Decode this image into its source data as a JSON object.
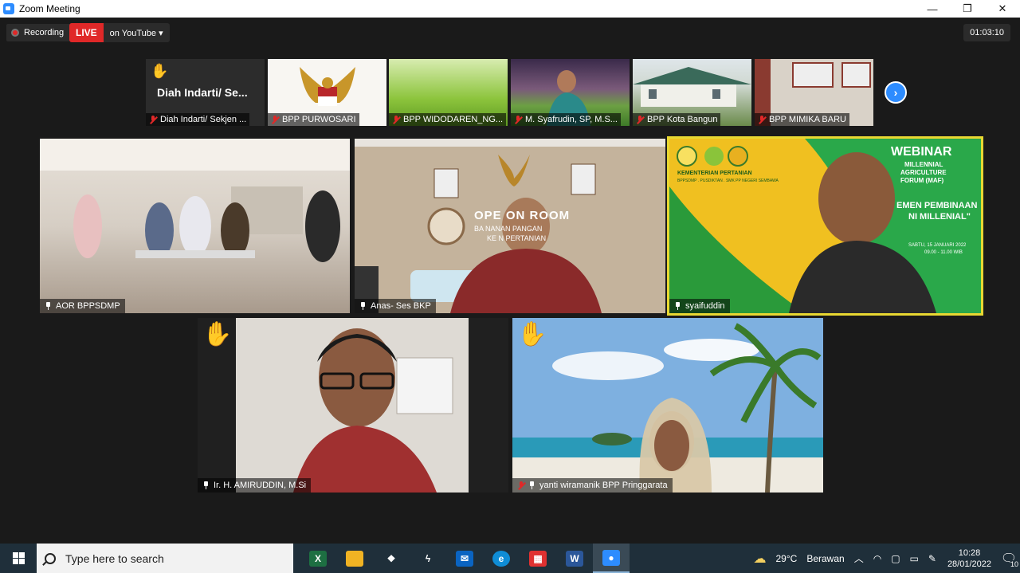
{
  "window": {
    "title": "Zoom Meeting",
    "controls": [
      "—",
      "❐",
      "✕"
    ]
  },
  "status": {
    "recording_label": "Recording",
    "live_label": "LIVE",
    "stream_target": "on YouTube",
    "stream_arrow": "▾",
    "elapsed": "01:03:10"
  },
  "thumbnails": [
    {
      "label": "Diah Indarti/ Sekjen ...",
      "overlay_name": "Diah Indarti/ Se...",
      "hand": "✋"
    },
    {
      "label": "BPP PURWOSARI"
    },
    {
      "label": "BPP WIDODAREN_NG..."
    },
    {
      "label": "M. Syafrudin, SP, M.S..."
    },
    {
      "label": "BPP Kota Bangun"
    },
    {
      "label": "BPP MIMIKA BARU"
    }
  ],
  "next_label": "›",
  "tiles": [
    {
      "label": "AOR BPPSDMP"
    },
    {
      "label": "Anas- Ses BKP",
      "room_sign": "OPE ON ROOM",
      "room_sub1": "BA NANAN PANGAN",
      "room_sub2": "KE N PERTANIAN"
    },
    {
      "label": "syaifuddin",
      "banner_title": "WEBINAR",
      "banner_l1": "MILLENNIAL",
      "banner_l2": "AGRICULTURE",
      "banner_l3": "FORUM (MAF)",
      "banner_l4": "EMEN PEMBINAAN",
      "banner_l5": "NI MILLENIAL\"",
      "banner_date": "SABTU, 15 JANUARI 2022",
      "banner_time": "09.00 - 11.00 WIB",
      "banner_org": "KEMENTERIAN PERTANIAN",
      "banner_org2": "BPPSDMP . PUSDIKTAN . SMK PP NEGERI SEMBAWA"
    },
    {
      "label": "Ir. H. AMIRUDDIN, M.Si",
      "hand": "✋"
    },
    {
      "label": "yanti wiramanik BPP Pringgarata",
      "hand": "✋"
    }
  ],
  "taskbar": {
    "search_placeholder": "Type here to search",
    "apps": [
      {
        "name": "excel",
        "glyph": "X",
        "color": "#1d6f42"
      },
      {
        "name": "file-explorer",
        "glyph": "",
        "color": "#f0b323"
      },
      {
        "name": "dropbox",
        "glyph": "❖",
        "color": "#1f2f3a"
      },
      {
        "name": "power-automate",
        "glyph": "ϟ",
        "color": "#1f2f3a"
      },
      {
        "name": "mail",
        "glyph": "✉",
        "color": "#0a64c2"
      },
      {
        "name": "edge",
        "glyph": "e",
        "color": "#0f8dd6"
      },
      {
        "name": "anydesk",
        "glyph": "▦",
        "color": "#e03131"
      },
      {
        "name": "word",
        "glyph": "W",
        "color": "#2b579a"
      },
      {
        "name": "zoom",
        "glyph": "●",
        "color": "#2d8cff"
      }
    ],
    "weather_temp": "29°C",
    "weather_desc": "Berawan",
    "time": "10:28",
    "date": "28/01/2022",
    "notification_count": "10"
  }
}
